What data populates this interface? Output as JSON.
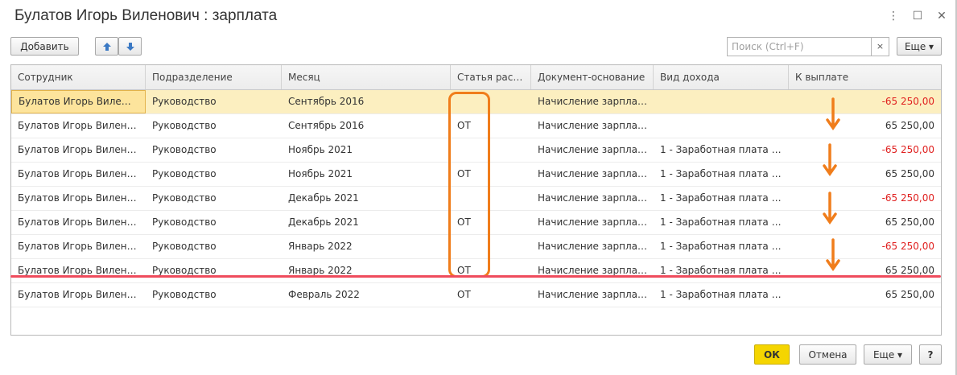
{
  "window": {
    "title": "Булатов Игорь Виленович : зарплата",
    "more_icon": "⋮",
    "maximize_icon": "☐",
    "close_icon": "✕"
  },
  "toolbar": {
    "add_label": "Добавить",
    "up_icon": "🡅",
    "down_icon": "🡇",
    "search_placeholder": "Поиск (Ctrl+F)",
    "search_clear_icon": "×",
    "more_label": "Еще ▾"
  },
  "table": {
    "columns": [
      "Сотрудник",
      "Подразделение",
      "Месяц",
      "Статья рас…",
      "Документ-основание",
      "Вид дохода",
      "К выплате"
    ],
    "rows": [
      {
        "employee": "Булатов Игорь Виле…",
        "dept": "Руководство",
        "month": "Сентябрь 2016",
        "article": "",
        "doc": "Начисление зарпла…",
        "income": "",
        "amount": "-65 250,00",
        "negative": true
      },
      {
        "employee": "Булатов Игорь Вилен…",
        "dept": "Руководство",
        "month": "Сентябрь 2016",
        "article": "ОТ",
        "doc": "Начисление зарпла…",
        "income": "",
        "amount": "65 250,00",
        "negative": false
      },
      {
        "employee": "Булатов Игорь Вилен…",
        "dept": "Руководство",
        "month": "Ноябрь 2021",
        "article": "",
        "doc": "Начисление зарпла…",
        "income": "1 - Заработная плата …",
        "amount": "-65 250,00",
        "negative": true
      },
      {
        "employee": "Булатов Игорь Вилен…",
        "dept": "Руководство",
        "month": "Ноябрь 2021",
        "article": "ОТ",
        "doc": "Начисление зарпла…",
        "income": "1 - Заработная плата …",
        "amount": "65 250,00",
        "negative": false
      },
      {
        "employee": "Булатов Игорь Вилен…",
        "dept": "Руководство",
        "month": "Декабрь 2021",
        "article": "",
        "doc": "Начисление зарпла…",
        "income": "1 - Заработная плата …",
        "amount": "-65 250,00",
        "negative": true
      },
      {
        "employee": "Булатов Игорь Вилен…",
        "dept": "Руководство",
        "month": "Декабрь 2021",
        "article": "ОТ",
        "doc": "Начисление зарпла…",
        "income": "1 - Заработная плата …",
        "amount": "65 250,00",
        "negative": false
      },
      {
        "employee": "Булатов Игорь Вилен…",
        "dept": "Руководство",
        "month": "Январь 2022",
        "article": "",
        "doc": "Начисление зарпла…",
        "income": "1 - Заработная плата …",
        "amount": "-65 250,00",
        "negative": true
      },
      {
        "employee": "Булатов Игорь Вилен…",
        "dept": "Руководство",
        "month": "Январь 2022",
        "article": "ОТ",
        "doc": "Начисление зарпла…",
        "income": "1 - Заработная плата …",
        "amount": "65 250,00",
        "negative": false
      },
      {
        "employee": "Булатов Игорь Вилен…",
        "dept": "Руководство",
        "month": "Февраль 2022",
        "article": "ОТ",
        "doc": "Начисление зарпла…",
        "income": "1 - Заработная плата …",
        "amount": "65 250,00",
        "negative": false
      }
    ]
  },
  "footer": {
    "ok_label": "ОК",
    "cancel_label": "Отмена",
    "more_label": "Еще ▾",
    "help_label": "?"
  },
  "annotations": {
    "highlight_color": "#f07d1b",
    "line_color": "#ef4c5d"
  }
}
